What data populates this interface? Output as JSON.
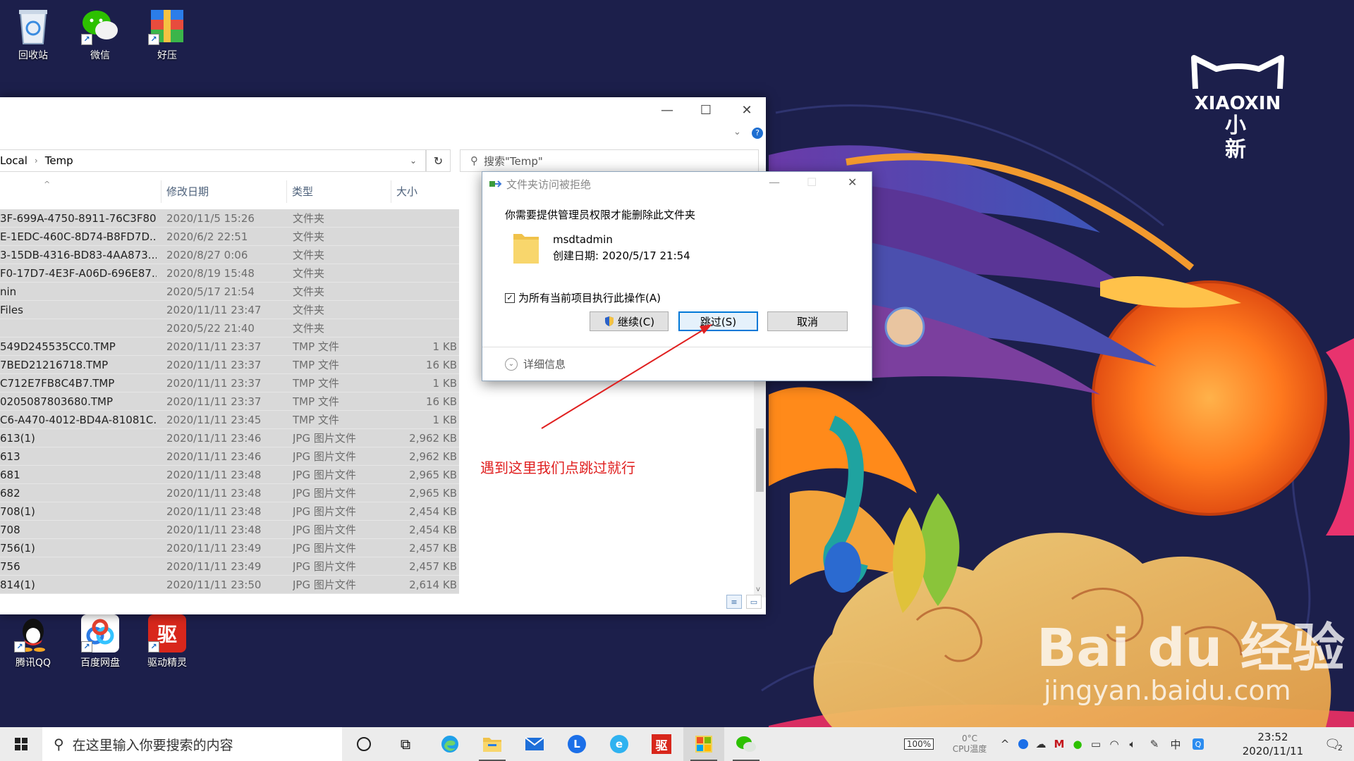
{
  "desktop": {
    "top_icons": [
      {
        "label": "回收站",
        "icon": "recycle-bin-icon"
      },
      {
        "label": "微信",
        "icon": "wechat-icon"
      },
      {
        "label": "好压",
        "icon": "haozip-icon"
      }
    ],
    "bottom_icons": [
      {
        "label": "腾讯QQ",
        "icon": "qq-icon"
      },
      {
        "label": "百度网盘",
        "icon": "baidu-netdisk-icon"
      },
      {
        "label": "驱动精灵",
        "icon": "driver-genius-icon",
        "glyph": "驱"
      }
    ],
    "brand": {
      "line1": "XIAOXIN",
      "line2": "小新"
    },
    "watermark": {
      "line1": "Bai du 经验",
      "line2": "jingyan.baidu.com"
    }
  },
  "explorer": {
    "breadcrumb": [
      "Local",
      "Temp"
    ],
    "search_placeholder": "搜索\"Temp\"",
    "columns": {
      "date": "修改日期",
      "type": "类型",
      "size": "大小"
    },
    "rows": [
      {
        "name": "3F-699A-4750-8911-76C3F80...",
        "date": "2020/11/5 15:26",
        "type": "文件夹",
        "size": ""
      },
      {
        "name": "E-1EDC-460C-8D74-B8FD7D...",
        "date": "2020/6/2 22:51",
        "type": "文件夹",
        "size": ""
      },
      {
        "name": "3-15DB-4316-BD83-4AA873...",
        "date": "2020/8/27 0:06",
        "type": "文件夹",
        "size": ""
      },
      {
        "name": "F0-17D7-4E3F-A06D-696E87...",
        "date": "2020/8/19 15:48",
        "type": "文件夹",
        "size": ""
      },
      {
        "name": "nin",
        "date": "2020/5/17 21:54",
        "type": "文件夹",
        "size": ""
      },
      {
        "name": "Files",
        "date": "2020/11/11 23:47",
        "type": "文件夹",
        "size": ""
      },
      {
        "name": "",
        "date": "2020/5/22 21:40",
        "type": "文件夹",
        "size": ""
      },
      {
        "name": "549D245535CC0.TMP",
        "date": "2020/11/11 23:37",
        "type": "TMP 文件",
        "size": "1 KB"
      },
      {
        "name": "7BED21216718.TMP",
        "date": "2020/11/11 23:37",
        "type": "TMP 文件",
        "size": "16 KB"
      },
      {
        "name": "C712E7FB8C4B7.TMP",
        "date": "2020/11/11 23:37",
        "type": "TMP 文件",
        "size": "1 KB"
      },
      {
        "name": "0205087803680.TMP",
        "date": "2020/11/11 23:37",
        "type": "TMP 文件",
        "size": "16 KB"
      },
      {
        "name": "C6-A470-4012-BD4A-81081C...",
        "date": "2020/11/11 23:45",
        "type": "TMP 文件",
        "size": "1 KB"
      },
      {
        "name": "613(1)",
        "date": "2020/11/11 23:46",
        "type": "JPG 图片文件",
        "size": "2,962 KB"
      },
      {
        "name": "613",
        "date": "2020/11/11 23:46",
        "type": "JPG 图片文件",
        "size": "2,962 KB"
      },
      {
        "name": "681",
        "date": "2020/11/11 23:48",
        "type": "JPG 图片文件",
        "size": "2,965 KB"
      },
      {
        "name": "682",
        "date": "2020/11/11 23:48",
        "type": "JPG 图片文件",
        "size": "2,965 KB"
      },
      {
        "name": "708(1)",
        "date": "2020/11/11 23:48",
        "type": "JPG 图片文件",
        "size": "2,454 KB"
      },
      {
        "name": "708",
        "date": "2020/11/11 23:48",
        "type": "JPG 图片文件",
        "size": "2,454 KB"
      },
      {
        "name": "756(1)",
        "date": "2020/11/11 23:49",
        "type": "JPG 图片文件",
        "size": "2,457 KB"
      },
      {
        "name": "756",
        "date": "2020/11/11 23:49",
        "type": "JPG 图片文件",
        "size": "2,457 KB"
      },
      {
        "name": "814(1)",
        "date": "2020/11/11 23:50",
        "type": "JPG 图片文件",
        "size": "2,614 KB"
      }
    ]
  },
  "dialog": {
    "title": "文件夹访问被拒绝",
    "message": "你需要提供管理员权限才能删除此文件夹",
    "folder_name": "msdtadmin",
    "folder_created": "创建日期: 2020/5/17 21:54",
    "checkbox_label": "为所有当前项目执行此操作(A)",
    "checkbox_checked": true,
    "buttons": {
      "continue": "继续(C)",
      "skip": "跳过(S)",
      "cancel": "取消"
    },
    "details": "详细信息"
  },
  "annotation": {
    "text": "遇到这里我们点跳过就行",
    "color": "#e02020"
  },
  "taskbar": {
    "search_placeholder": "在这里输入你要搜索的内容",
    "battery": "100%",
    "cpu_temp": "0°C",
    "cpu_label": "CPU温度",
    "time": "23:52",
    "date": "2020/11/11",
    "notification_count": "2"
  }
}
